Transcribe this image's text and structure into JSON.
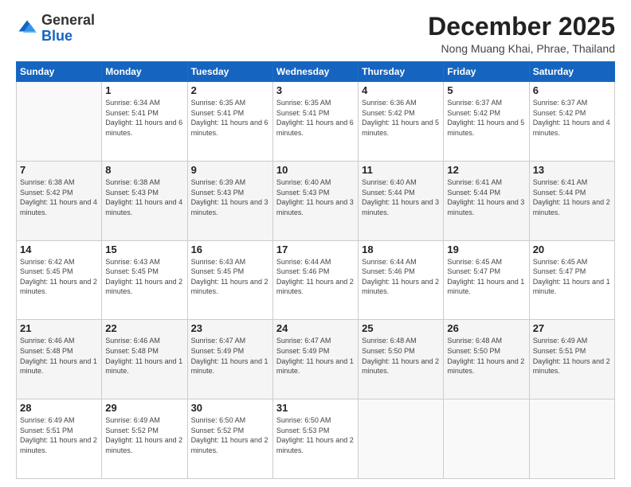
{
  "header": {
    "logo": {
      "general": "General",
      "blue": "Blue"
    },
    "title": "December 2025",
    "location": "Nong Muang Khai, Phrae, Thailand"
  },
  "calendar": {
    "days_of_week": [
      "Sunday",
      "Monday",
      "Tuesday",
      "Wednesday",
      "Thursday",
      "Friday",
      "Saturday"
    ],
    "weeks": [
      [
        {
          "day": "",
          "empty": true
        },
        {
          "day": "1",
          "sunrise": "6:34 AM",
          "sunset": "5:41 PM",
          "daylight": "11 hours and 6 minutes."
        },
        {
          "day": "2",
          "sunrise": "6:35 AM",
          "sunset": "5:41 PM",
          "daylight": "11 hours and 6 minutes."
        },
        {
          "day": "3",
          "sunrise": "6:35 AM",
          "sunset": "5:41 PM",
          "daylight": "11 hours and 6 minutes."
        },
        {
          "day": "4",
          "sunrise": "6:36 AM",
          "sunset": "5:42 PM",
          "daylight": "11 hours and 5 minutes."
        },
        {
          "day": "5",
          "sunrise": "6:37 AM",
          "sunset": "5:42 PM",
          "daylight": "11 hours and 5 minutes."
        },
        {
          "day": "6",
          "sunrise": "6:37 AM",
          "sunset": "5:42 PM",
          "daylight": "11 hours and 4 minutes."
        }
      ],
      [
        {
          "day": "7",
          "sunrise": "6:38 AM",
          "sunset": "5:42 PM",
          "daylight": "11 hours and 4 minutes."
        },
        {
          "day": "8",
          "sunrise": "6:38 AM",
          "sunset": "5:43 PM",
          "daylight": "11 hours and 4 minutes."
        },
        {
          "day": "9",
          "sunrise": "6:39 AM",
          "sunset": "5:43 PM",
          "daylight": "11 hours and 3 minutes."
        },
        {
          "day": "10",
          "sunrise": "6:40 AM",
          "sunset": "5:43 PM",
          "daylight": "11 hours and 3 minutes."
        },
        {
          "day": "11",
          "sunrise": "6:40 AM",
          "sunset": "5:44 PM",
          "daylight": "11 hours and 3 minutes."
        },
        {
          "day": "12",
          "sunrise": "6:41 AM",
          "sunset": "5:44 PM",
          "daylight": "11 hours and 3 minutes."
        },
        {
          "day": "13",
          "sunrise": "6:41 AM",
          "sunset": "5:44 PM",
          "daylight": "11 hours and 2 minutes."
        }
      ],
      [
        {
          "day": "14",
          "sunrise": "6:42 AM",
          "sunset": "5:45 PM",
          "daylight": "11 hours and 2 minutes."
        },
        {
          "day": "15",
          "sunrise": "6:43 AM",
          "sunset": "5:45 PM",
          "daylight": "11 hours and 2 minutes."
        },
        {
          "day": "16",
          "sunrise": "6:43 AM",
          "sunset": "5:45 PM",
          "daylight": "11 hours and 2 minutes."
        },
        {
          "day": "17",
          "sunrise": "6:44 AM",
          "sunset": "5:46 PM",
          "daylight": "11 hours and 2 minutes."
        },
        {
          "day": "18",
          "sunrise": "6:44 AM",
          "sunset": "5:46 PM",
          "daylight": "11 hours and 2 minutes."
        },
        {
          "day": "19",
          "sunrise": "6:45 AM",
          "sunset": "5:47 PM",
          "daylight": "11 hours and 1 minute."
        },
        {
          "day": "20",
          "sunrise": "6:45 AM",
          "sunset": "5:47 PM",
          "daylight": "11 hours and 1 minute."
        }
      ],
      [
        {
          "day": "21",
          "sunrise": "6:46 AM",
          "sunset": "5:48 PM",
          "daylight": "11 hours and 1 minute."
        },
        {
          "day": "22",
          "sunrise": "6:46 AM",
          "sunset": "5:48 PM",
          "daylight": "11 hours and 1 minute."
        },
        {
          "day": "23",
          "sunrise": "6:47 AM",
          "sunset": "5:49 PM",
          "daylight": "11 hours and 1 minute."
        },
        {
          "day": "24",
          "sunrise": "6:47 AM",
          "sunset": "5:49 PM",
          "daylight": "11 hours and 1 minute."
        },
        {
          "day": "25",
          "sunrise": "6:48 AM",
          "sunset": "5:50 PM",
          "daylight": "11 hours and 2 minutes."
        },
        {
          "day": "26",
          "sunrise": "6:48 AM",
          "sunset": "5:50 PM",
          "daylight": "11 hours and 2 minutes."
        },
        {
          "day": "27",
          "sunrise": "6:49 AM",
          "sunset": "5:51 PM",
          "daylight": "11 hours and 2 minutes."
        }
      ],
      [
        {
          "day": "28",
          "sunrise": "6:49 AM",
          "sunset": "5:51 PM",
          "daylight": "11 hours and 2 minutes."
        },
        {
          "day": "29",
          "sunrise": "6:49 AM",
          "sunset": "5:52 PM",
          "daylight": "11 hours and 2 minutes."
        },
        {
          "day": "30",
          "sunrise": "6:50 AM",
          "sunset": "5:52 PM",
          "daylight": "11 hours and 2 minutes."
        },
        {
          "day": "31",
          "sunrise": "6:50 AM",
          "sunset": "5:53 PM",
          "daylight": "11 hours and 2 minutes."
        },
        {
          "day": "",
          "empty": true
        },
        {
          "day": "",
          "empty": true
        },
        {
          "day": "",
          "empty": true
        }
      ]
    ]
  }
}
